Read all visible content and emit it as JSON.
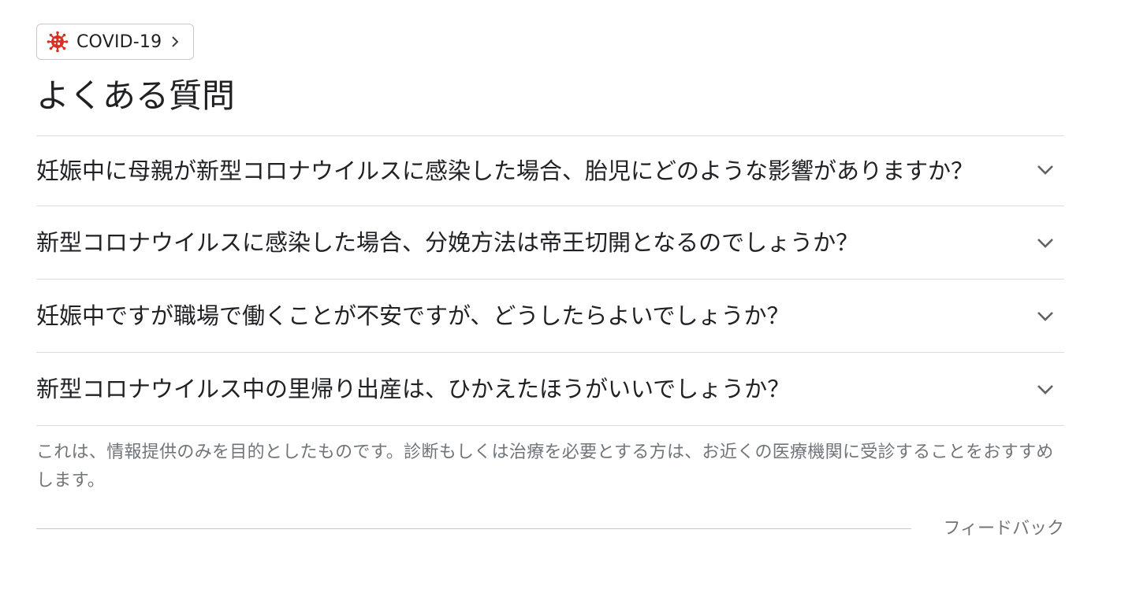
{
  "chip": {
    "label": "COVID-19",
    "icon": "virus-icon",
    "icon_color": "#d93025",
    "chevron": "chevron-right-icon"
  },
  "title": "よくある質問",
  "faq": {
    "items": [
      {
        "question": "妊娠中に母親が新型コロナウイルスに感染した場合、胎児にどのような影響がありますか？"
      },
      {
        "question": "新型コロナウイルスに感染した場合、分娩方法は帝王切開となるのでしょうか？"
      },
      {
        "question": "妊娠中ですが職場で働くことが不安ですが、どうしたらよいでしょうか？"
      },
      {
        "question": "新型コロナウイルス中の里帰り出産は、ひかえたほうがいいでしょうか？"
      }
    ],
    "expand_icon": "chevron-down-icon"
  },
  "disclaimer": "これは、情報提供のみを目的としたものです。診断もしくは治療を必要とする方は、お近くの医療機関に受診することをおすすめします。",
  "feedback": "フィードバック"
}
